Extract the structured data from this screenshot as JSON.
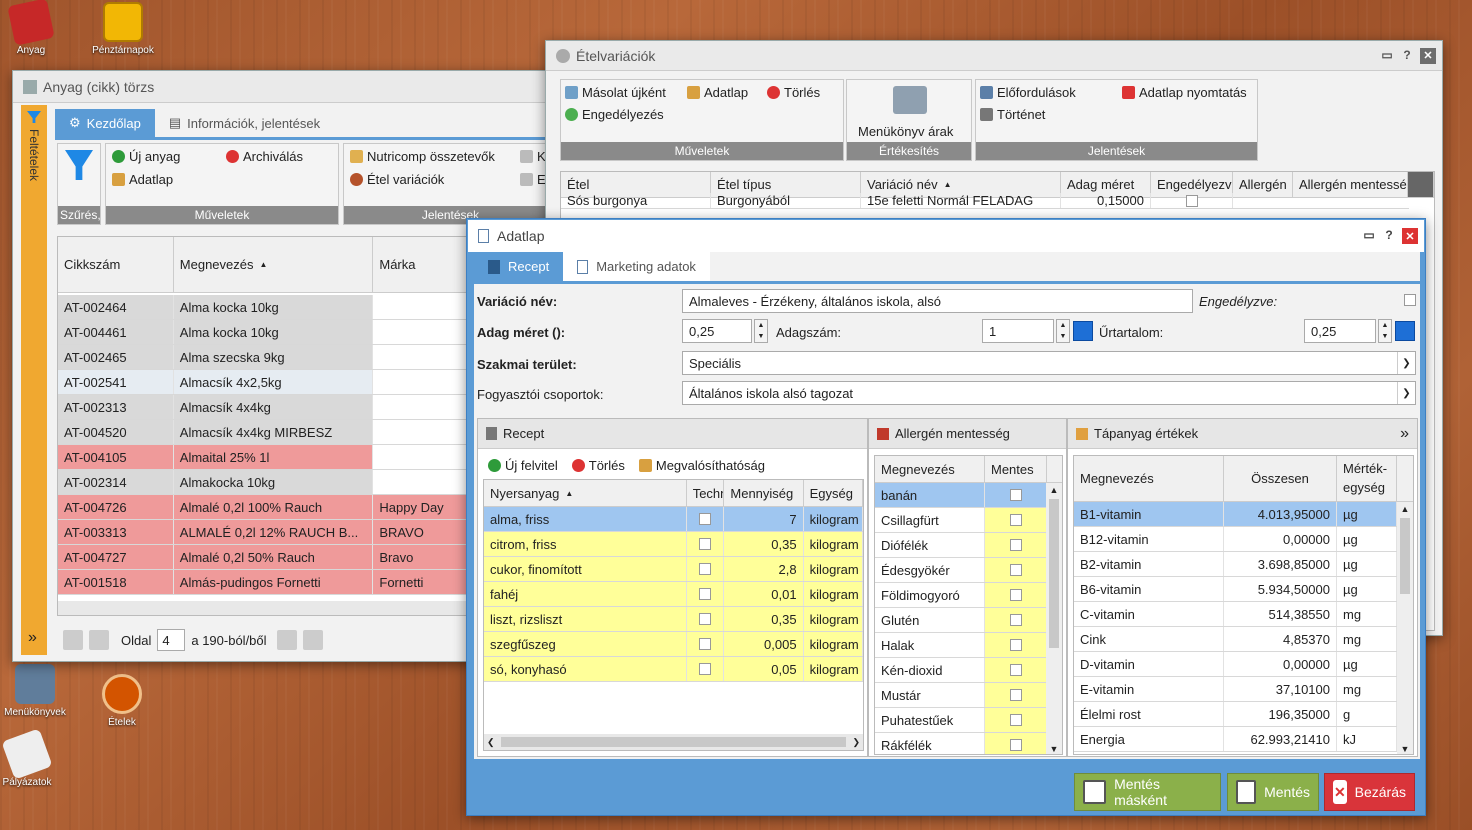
{
  "desktop": {
    "icons": [
      "Anyag",
      "Pénztárnapok",
      "Menükönyvek",
      "Ételek",
      "Pályázatok"
    ]
  },
  "anyag": {
    "title": "Anyag (cikk) törzs",
    "side_label": "Feltételek",
    "tabs": [
      "Kezdőlap",
      "Információk, jelentések"
    ],
    "filter_label": "Szűrés,",
    "actions": {
      "new": "Új anyag",
      "archive": "Archiválás",
      "datasheet": "Adatlap",
      "group": "Műveletek"
    },
    "reports": {
      "nutricomp": "Nutricomp összetevők",
      "variations": "Étel variációk",
      "k": "K",
      "e": "E",
      "group": "Jelentések"
    },
    "columns": [
      "Cikkszám",
      "Megnevezés",
      "Márka"
    ],
    "rows": [
      {
        "code": "AT-002464",
        "name": "Alma kocka 10kg",
        "brand": "",
        "color": "#d9d9d9"
      },
      {
        "code": "AT-004461",
        "name": "Alma kocka 10kg",
        "brand": "",
        "color": "#d9d9d9"
      },
      {
        "code": "AT-002465",
        "name": "Alma szecska 9kg",
        "brand": "",
        "color": "#d9d9d9"
      },
      {
        "code": "AT-002541",
        "name": "Almacsík 4x2,5kg",
        "brand": "",
        "color": "#e6ecf2"
      },
      {
        "code": "AT-002313",
        "name": "Almacsík 4x4kg",
        "brand": "",
        "color": "#d9d9d9"
      },
      {
        "code": "AT-004520",
        "name": "Almacsík 4x4kg MIRBESZ",
        "brand": "",
        "color": "#d9d9d9"
      },
      {
        "code": "AT-004105",
        "name": "Almaital 25% 1l",
        "brand": "",
        "color": "#ef9a9a"
      },
      {
        "code": "AT-002314",
        "name": "Almakocka 10kg",
        "brand": "",
        "color": "#d9d9d9"
      },
      {
        "code": "AT-004726",
        "name": "Almalé 0,2l 100% Rauch",
        "brand": "Happy Day",
        "color": "#ef9a9a"
      },
      {
        "code": "AT-003313",
        "name": "ALMALÉ 0,2l 12% RAUCH B...",
        "brand": "BRAVO",
        "color": "#ef9a9a"
      },
      {
        "code": "AT-004727",
        "name": "Almalé 0,2l 50% Rauch",
        "brand": "Bravo",
        "color": "#ef9a9a"
      },
      {
        "code": "AT-001518",
        "name": "Almás-pudingos Fornetti",
        "brand": "Fornetti",
        "color": "#ef9a9a"
      }
    ],
    "pager": {
      "page_label": "Oldal",
      "page": "4",
      "of": "a 190-ból/ből"
    }
  },
  "etelvar": {
    "title": "Ételvariációk",
    "ops": {
      "copy": "Másolat újként",
      "datasheet": "Adatlap",
      "delete": "Törlés",
      "approve": "Engedélyezés",
      "group": "Műveletek"
    },
    "sales": {
      "menu_prices": "Menükönyv árak",
      "group": "Értékesítés"
    },
    "reports": {
      "occurrences": "Előfordulások",
      "print": "Adatlap nyomtatás",
      "history": "Történet",
      "group": "Jelentések"
    },
    "columns": [
      "Étel",
      "Étel típus",
      "Variáció név",
      "Adag méret",
      "Engedélyezv",
      "Allergén",
      "Allergén mentessé"
    ],
    "row": {
      "etel": "Sós burgonya",
      "tipus": "Burgonyából",
      "variacio": "15e feletti Normál FELADAG",
      "adag": "0,15000"
    }
  },
  "adatlap": {
    "title": "Adatlap",
    "tabs": [
      "Recept",
      "Marketing adatok"
    ],
    "fields": {
      "variacio_label": "Variáció név:",
      "variacio_value": "Almaleves - Érzékeny, általános iskola, alsó",
      "engedely_label": "Engedélyzve:",
      "adag_label": "Adag méret ():",
      "adag_value": "0,25",
      "adagszam_label": "Adagszám:",
      "adagszam_value": "1",
      "urtartalom_label": "Űrtartalom:",
      "urtartalom_value": "0,25",
      "szakmai_label": "Szakmai terület:",
      "szakmai_value": "Speciális",
      "fogyaszto_label": "Fogyasztói csoportok:",
      "fogyaszto_value": "Általános iskola alsó tagozat"
    },
    "recept": {
      "title": "Recept",
      "toolbar": {
        "new": "Új felvitel",
        "delete": "Törlés",
        "feasibility": "Megvalósíthatóság"
      },
      "columns": [
        "Nyersanyag",
        "Techn",
        "Mennyiség",
        "Egység"
      ],
      "rows": [
        {
          "name": "alma, friss",
          "qty": "7",
          "unit": "kilogram"
        },
        {
          "name": "citrom, friss",
          "qty": "0,35",
          "unit": "kilogram"
        },
        {
          "name": "cukor, finomított",
          "qty": "2,8",
          "unit": "kilogram"
        },
        {
          "name": "fahéj",
          "qty": "0,01",
          "unit": "kilogram"
        },
        {
          "name": "liszt, rizsliszt",
          "qty": "0,35",
          "unit": "kilogram"
        },
        {
          "name": "szegfűszeg",
          "qty": "0,005",
          "unit": "kilogram"
        },
        {
          "name": "só, konyhasó",
          "qty": "0,05",
          "unit": "kilogram"
        }
      ]
    },
    "allergen": {
      "title": "Allergén mentesség",
      "columns": [
        "Megnevezés",
        "Mentes"
      ],
      "rows": [
        "banán",
        "Csillagfürt",
        "Diófélék",
        "Édesgyökér",
        "Földimogyoró",
        "Glutén",
        "Halak",
        "Kén-dioxid",
        "Mustár",
        "Puhatestűek",
        "Rákfélék"
      ]
    },
    "tapanyag": {
      "title": "Tápanyag értékek",
      "columns": [
        "Megnevezés",
        "Összesen",
        "Mérték-egység"
      ],
      "rows": [
        {
          "name": "B1-vitamin",
          "total": "4.013,95000",
          "unit": "µg"
        },
        {
          "name": "B12-vitamin",
          "total": "0,00000",
          "unit": "µg"
        },
        {
          "name": "B2-vitamin",
          "total": "3.698,85000",
          "unit": "µg"
        },
        {
          "name": "B6-vitamin",
          "total": "5.934,50000",
          "unit": "µg"
        },
        {
          "name": "C-vitamin",
          "total": "514,38550",
          "unit": "mg"
        },
        {
          "name": "Cink",
          "total": "4,85370",
          "unit": "mg"
        },
        {
          "name": "D-vitamin",
          "total": "0,00000",
          "unit": "µg"
        },
        {
          "name": "E-vitamin",
          "total": "37,10100",
          "unit": "mg"
        },
        {
          "name": "Élelmi rost",
          "total": "196,35000",
          "unit": "g"
        },
        {
          "name": "Energia",
          "total": "62.993,21410",
          "unit": "kJ"
        }
      ]
    },
    "buttons": {
      "save_as": "Mentés másként",
      "save": "Mentés",
      "close": "Bezárás"
    }
  },
  "colors": {
    "accent_blue": "#5b9bd5",
    "yellow_row": "#ffff99",
    "selected_row": "#9fc6f0",
    "green_btn": "#8bb04a",
    "red_btn": "#d9343a",
    "pink_row": "#ef9a9a"
  }
}
